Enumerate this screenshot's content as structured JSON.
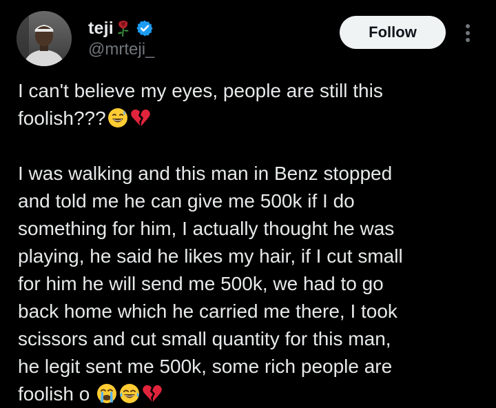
{
  "user": {
    "display_name": "teji",
    "handle": "@mrteji_",
    "verified": true,
    "name_emoji": "wilted-rose-icon"
  },
  "actions": {
    "follow_label": "Follow",
    "more_icon": "more-vertical-icon"
  },
  "tweet": {
    "lines_paragraph1": [
      "I can't believe my eyes, people are still this",
      "foolish???"
    ],
    "lines_paragraph2": [
      "I was walking and this man in Benz stopped",
      "and told me he can give me 500k if I do",
      "something for him, I actually thought he was",
      "playing, he said he likes my hair, if I cut small",
      "for him he will send me 500k, we had to go",
      "back home which he carried me there, I took",
      "scissors and cut small quantity for this man,",
      "he legit sent me 500k, some rich people are",
      "foolish o"
    ],
    "emojis_paragraph1": [
      "grinning-sweat-icon",
      "broken-heart-icon"
    ],
    "emojis_paragraph2": [
      "loudly-crying-icon",
      "tears-of-joy-icon",
      "broken-heart-icon"
    ]
  },
  "colors": {
    "background": "#000000",
    "text_primary": "#e7e9ea",
    "text_secondary": "#71767b",
    "verified_blue": "#1d9bf0",
    "follow_bg": "#eff3f4"
  }
}
